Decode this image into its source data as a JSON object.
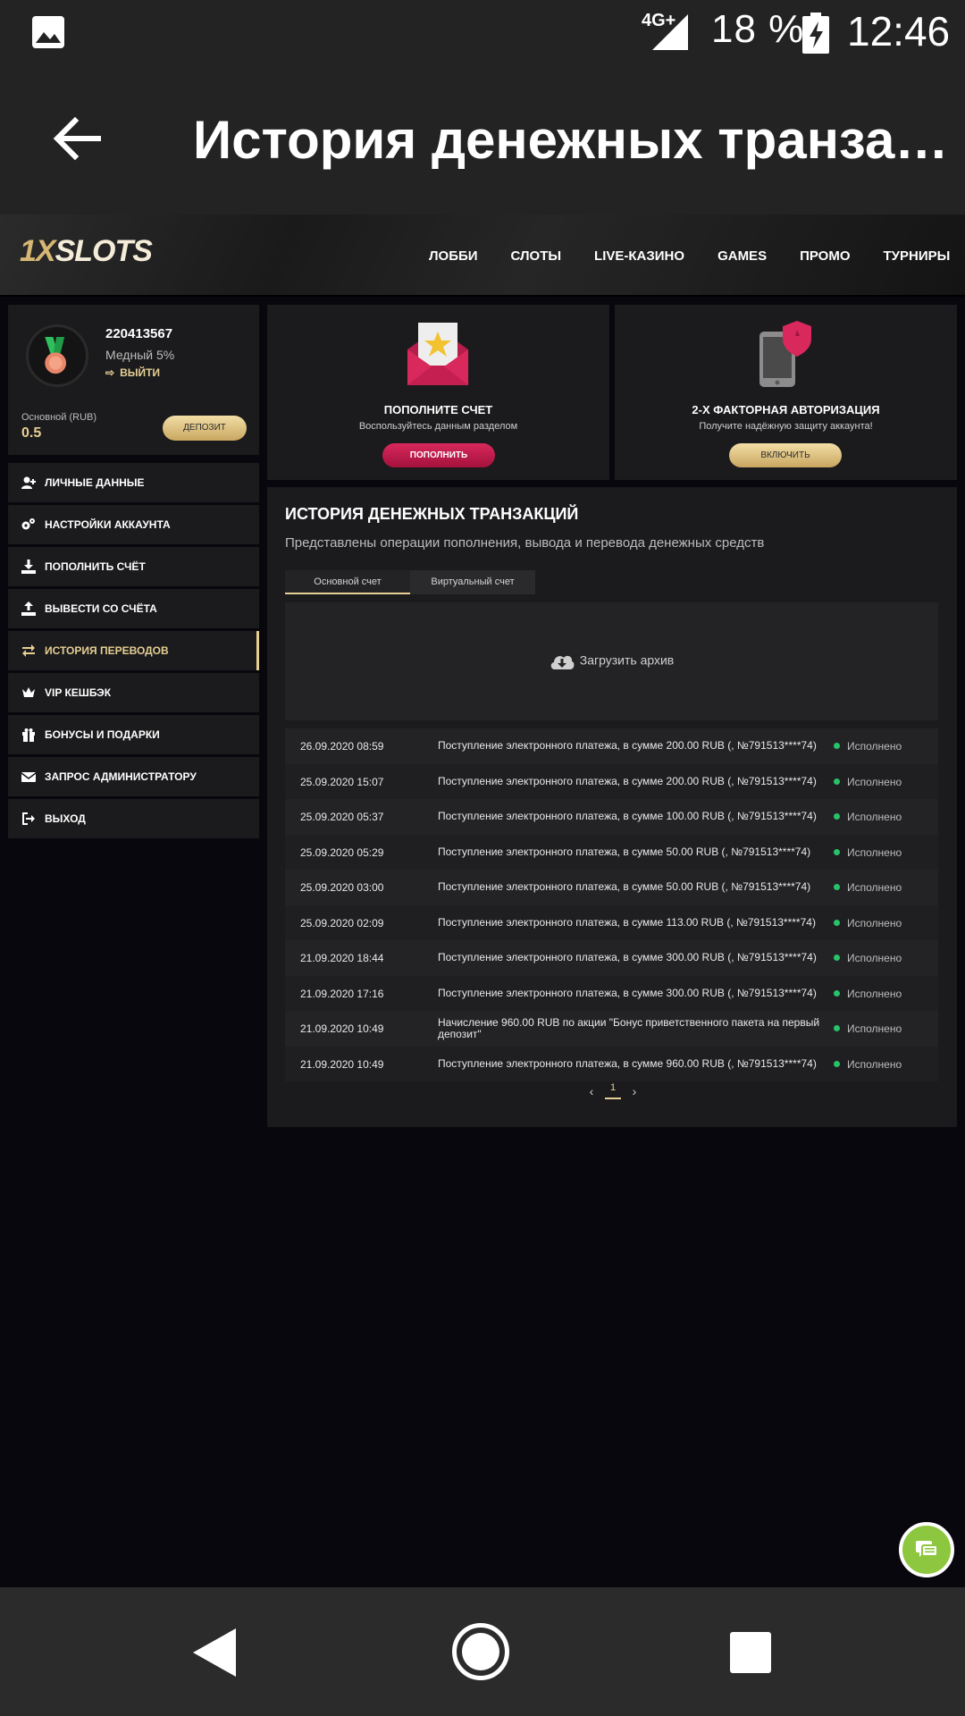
{
  "status_bar": {
    "network": "4G+",
    "battery_percent": "18 %",
    "time": "12:46",
    "icons": [
      "image-icon",
      "signal-icon",
      "battery-charging-icon"
    ]
  },
  "app_bar": {
    "title": "История денежных транза…",
    "back_icon": "back-arrow-icon"
  },
  "site_header": {
    "logo": {
      "part1": "1X",
      "part2": "SLOTS"
    },
    "nav": [
      "ЛОББИ",
      "СЛОТЫ",
      "LIVE-КАЗИНО",
      "GAMES",
      "ПРОМО",
      "ТУРНИРЫ"
    ]
  },
  "profile": {
    "user_id": "220413567",
    "level": "Медный 5%",
    "logout": "ВЫЙТИ",
    "balance_label": "Основной (RUB)",
    "balance_value": "0.5",
    "deposit_button": "ДЕПОЗИТ"
  },
  "side_menu": [
    {
      "label": "ЛИЧНЫЕ ДАННЫЕ",
      "icon": "user-plus-icon"
    },
    {
      "label": "НАСТРОЙКИ АККАУНТА",
      "icon": "cogs-icon"
    },
    {
      "label": "ПОПОЛНИТЬ СЧЁТ",
      "icon": "download-icon"
    },
    {
      "label": "ВЫВЕСТИ СО СЧЁТА",
      "icon": "upload-icon"
    },
    {
      "label": "ИСТОРИЯ ПЕРЕВОДОВ",
      "icon": "exchange-icon",
      "active": true
    },
    {
      "label": "VIP КЕШБЭК",
      "icon": "crown-icon"
    },
    {
      "label": "БОНУСЫ И ПОДАРКИ",
      "icon": "gift-icon"
    },
    {
      "label": "ЗАПРОС АДМИНИСТРАТОРУ",
      "icon": "envelope-icon"
    },
    {
      "label": "ВЫХОД",
      "icon": "sign-out-icon"
    }
  ],
  "promo_cards": [
    {
      "title": "ПОПОЛНИТЕ СЧЕТ",
      "subtitle": "Воспользуйтесь данным разделом",
      "button": "ПОПОЛНИТЬ",
      "icon": "envelope-star-icon"
    },
    {
      "title": "2-Х ФАКТОРНАЯ АВТОРИЗАЦИЯ",
      "subtitle": "Получите надёжную защиту аккаунта!",
      "button": "ВКЛЮЧИТЬ",
      "icon": "phone-shield-icon"
    }
  ],
  "main": {
    "title": "ИСТОРИЯ ДЕНЕЖНЫХ ТРАНЗАКЦИЙ",
    "subtitle": "Представлены операции пополнения, вывода и перевода денежных средств",
    "tabs": [
      "Основной счет",
      "Виртуальный счет"
    ],
    "active_tab": 0,
    "archive_button": "Загрузить архив",
    "transactions": [
      {
        "date": "26.09.2020 08:59",
        "description": "Поступление электронного платежа, в сумме 200.00 RUB (, №791513****74)",
        "status": "Исполнено"
      },
      {
        "date": "25.09.2020 15:07",
        "description": "Поступление электронного платежа, в сумме 200.00 RUB (, №791513****74)",
        "status": "Исполнено"
      },
      {
        "date": "25.09.2020 05:37",
        "description": "Поступление электронного платежа, в сумме 100.00 RUB (, №791513****74)",
        "status": "Исполнено"
      },
      {
        "date": "25.09.2020 05:29",
        "description": "Поступление электронного платежа, в сумме 50.00 RUB (, №791513****74)",
        "status": "Исполнено"
      },
      {
        "date": "25.09.2020 03:00",
        "description": "Поступление электронного платежа, в сумме 50.00 RUB (, №791513****74)",
        "status": "Исполнено"
      },
      {
        "date": "25.09.2020 02:09",
        "description": "Поступление электронного платежа, в сумме 113.00 RUB (, №791513****74)",
        "status": "Исполнено"
      },
      {
        "date": "21.09.2020 18:44",
        "description": "Поступление электронного платежа, в сумме 300.00 RUB (, №791513****74)",
        "status": "Исполнено"
      },
      {
        "date": "21.09.2020 17:16",
        "description": "Поступление электронного платежа, в сумме 300.00 RUB (, №791513****74)",
        "status": "Исполнено"
      },
      {
        "date": "21.09.2020 10:49",
        "description": "Начисление 960.00 RUB по акции \"Бонус приветственного пакета на первый депозит\"",
        "status": "Исполнено"
      },
      {
        "date": "21.09.2020 10:49",
        "description": "Поступление электронного платежа, в сумме 960.00 RUB (, №791513****74)",
        "status": "Исполнено"
      }
    ],
    "pagination": {
      "prev": "‹",
      "current": "1",
      "next": "›"
    }
  },
  "colors": {
    "accent_gold": "#e6cf93",
    "accent_pink": "#d8285c",
    "status_green": "#27c26a",
    "chat_green": "#8dc63f"
  },
  "chat_button_icon": "chat-icon"
}
